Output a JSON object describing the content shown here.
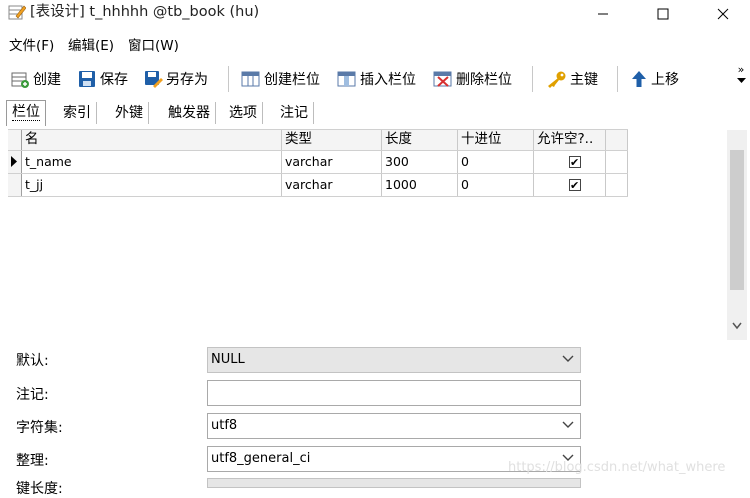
{
  "window": {
    "title": "[表设计] t_hhhhh @tb_book (hu)"
  },
  "menu": {
    "items": [
      "文件(F)",
      "编辑(E)",
      "窗口(W)"
    ]
  },
  "toolbar": {
    "create": "创建",
    "save": "保存",
    "save_as": "另存为",
    "create_field": "创建栏位",
    "insert_field": "插入栏位",
    "delete_field": "删除栏位",
    "primary_key": "主键",
    "move_up": "上移",
    "more": "»"
  },
  "tabs": [
    "栏位",
    "索引",
    "外键",
    "触发器",
    "选项",
    "注记"
  ],
  "grid": {
    "headers": [
      "名",
      "类型",
      "长度",
      "十进位",
      "允许空?.."
    ],
    "rows": [
      {
        "name": "t_name",
        "type": "varchar",
        "length": "300",
        "decimal": "0",
        "nullable": "✔"
      },
      {
        "name": "t_jj",
        "type": "varchar",
        "length": "1000",
        "decimal": "0",
        "nullable": "✔"
      }
    ]
  },
  "properties": {
    "default_label": "默认:",
    "default_value": "NULL",
    "comment_label": "注记:",
    "comment_value": "",
    "charset_label": "字符集:",
    "charset_value": "utf8",
    "collation_label": "整理:",
    "collation_value": "utf8_general_ci",
    "keylen_label": "键长度:"
  },
  "watermark": "https://blog.csdn.net/what_where",
  "colors": {
    "pencil": "#f0a020",
    "disk": "#1f5fa8",
    "red_x": "#d83030",
    "key": "#e0a000",
    "arrow": "#1f5fa8"
  }
}
